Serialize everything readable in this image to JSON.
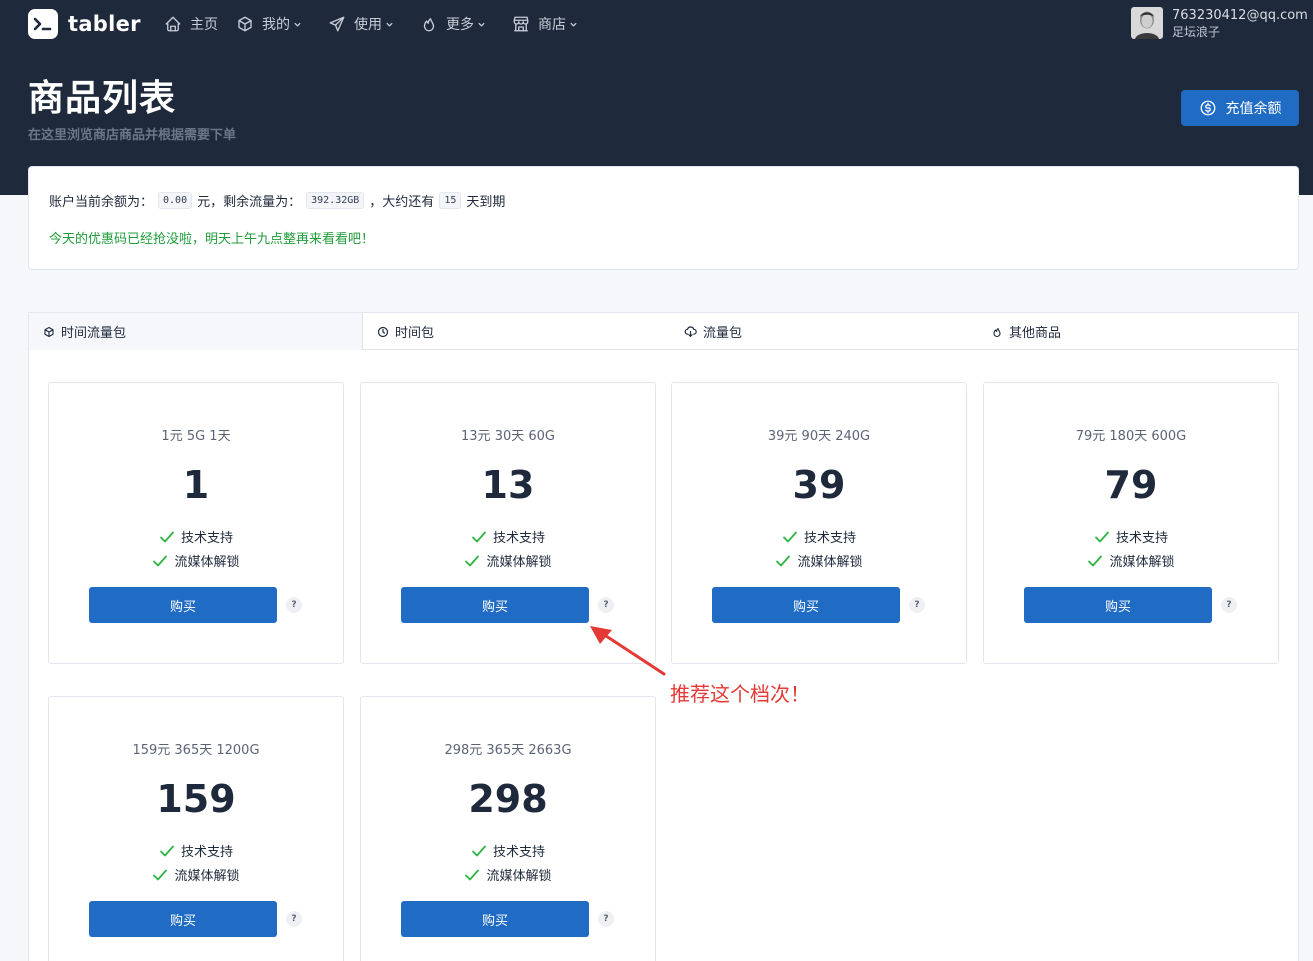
{
  "brand": {
    "name": "tabler"
  },
  "nav": [
    {
      "label": "主页",
      "icon": "home-icon",
      "dropdown": false
    },
    {
      "label": "我的",
      "icon": "box-icon",
      "dropdown": true
    },
    {
      "label": "使用",
      "icon": "send-icon",
      "dropdown": true
    },
    {
      "label": "更多",
      "icon": "flame-icon",
      "dropdown": true
    },
    {
      "label": "商店",
      "icon": "store-icon",
      "dropdown": true
    }
  ],
  "user": {
    "email": "763230412@qq.com",
    "name": "足坛浪子"
  },
  "header": {
    "title": "商品列表",
    "subtitle": "在这里浏览商店商品并根据需要下单",
    "recharge_label": "充值余额"
  },
  "account": {
    "balance_prefix": "账户当前余额为：",
    "balance": "0.00",
    "balance_unit": "元，剩余流量为：",
    "traffic": "392.32GB",
    "days_prefix": "，大约还有",
    "days": "15",
    "days_suffix": "天到期",
    "promo": "今天的优惠码已经抢没啦，明天上午九点整再来看看吧！"
  },
  "tabs": [
    {
      "label": "时间流量包",
      "icon": "box-icon",
      "active": true
    },
    {
      "label": "时间包",
      "icon": "clock-icon",
      "active": false
    },
    {
      "label": "流量包",
      "icon": "cloud-download-icon",
      "active": false
    },
    {
      "label": "其他商品",
      "icon": "flame-icon",
      "active": false
    }
  ],
  "products": [
    {
      "title": "1元 5G 1天",
      "price": "1",
      "features": [
        "技术支持",
        "流媒体解锁"
      ],
      "buy_label": "购买",
      "help": "?"
    },
    {
      "title": "13元 30天 60G",
      "price": "13",
      "features": [
        "技术支持",
        "流媒体解锁"
      ],
      "buy_label": "购买",
      "help": "?"
    },
    {
      "title": "39元 90天 240G",
      "price": "39",
      "features": [
        "技术支持",
        "流媒体解锁"
      ],
      "buy_label": "购买",
      "help": "?"
    },
    {
      "title": "79元 180天 600G",
      "price": "79",
      "features": [
        "技术支持",
        "流媒体解锁"
      ],
      "buy_label": "购买",
      "help": "?"
    },
    {
      "title": "159元 365天 1200G",
      "price": "159",
      "features": [
        "技术支持",
        "流媒体解锁"
      ],
      "buy_label": "购买",
      "help": "?"
    },
    {
      "title": "298元 365天 2663G",
      "price": "298",
      "features": [
        "技术支持",
        "流媒体解锁"
      ],
      "buy_label": "购买",
      "help": "?"
    }
  ],
  "annotation": "推荐这个档次！",
  "colors": {
    "primary": "#206bc4",
    "header": "#1e293b",
    "success": "#2fb344",
    "annotation": "#e53935"
  }
}
